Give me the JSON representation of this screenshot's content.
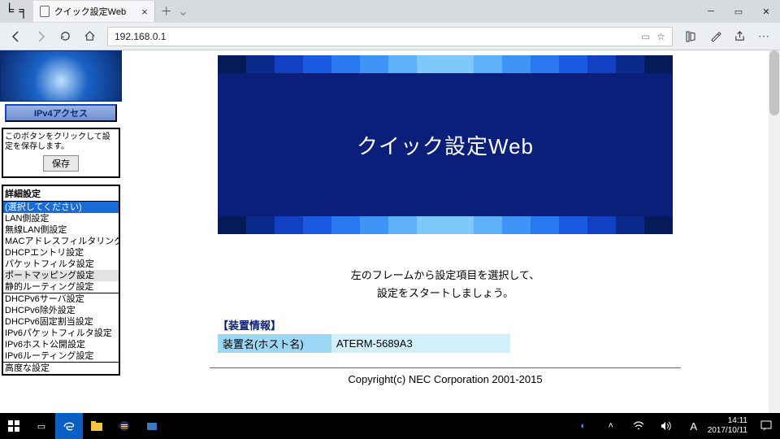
{
  "browser": {
    "tab_title": "クイック設定Web",
    "url": "192.168.0.1"
  },
  "sidebar": {
    "ipv4_button": "IPv4アクセス",
    "save_hint": "このボタンをクリックして設定を保存します。",
    "save_button": "保存",
    "list_header": "詳細設定",
    "group1": [
      "(選択してください)",
      "LAN側設定",
      "無線LAN側設定",
      "MACアドレスフィルタリング",
      "DHCPエントリ設定",
      "パケットフィルタ設定",
      "ポートマッピング設定",
      "静的ルーティング設定"
    ],
    "group2": [
      "DHCPv6サーバ設定",
      "DHCPv6除外設定",
      "DHCPv6固定割当設定",
      "IPv6パケットフィルタ設定",
      "IPv6ホスト公開設定",
      "IPv6ルーティング設定"
    ],
    "group3": [
      "高度な設定"
    ]
  },
  "banner": {
    "title": "クイック設定Web"
  },
  "main": {
    "line1": "左のフレームから設定項目を選択して、",
    "line2": "設定をスタートしましょう。",
    "info_heading": "【装置情報】",
    "row1_key": "装置名(ホスト名)",
    "row1_val": "ATERM-5689A3",
    "copyright": "Copyright(c) NEC Corporation 2001-2015"
  },
  "taskbar": {
    "time": "14:11",
    "date": "2017/10/11",
    "ime": "A"
  },
  "stripA": [
    "#061a5a",
    "#0a2a8c",
    "#1140c2",
    "#1a5ae0",
    "#2a78f0",
    "#3e94f4",
    "#5eb0f8",
    "#7ec8fc",
    "#7ec8fc",
    "#5eb0f8",
    "#3e94f4",
    "#2a78f0",
    "#1a5ae0",
    "#1140c2",
    "#0a2a8c",
    "#061a5a"
  ],
  "stripB": [
    "#061a5a",
    "#0a2a8c",
    "#1140c2",
    "#1a5ae0",
    "#2a78f0",
    "#3e94f4",
    "#5eb0f8",
    "#7ec8fc",
    "#7ec8fc",
    "#5eb0f8",
    "#3e94f4",
    "#2a78f0",
    "#1a5ae0",
    "#1140c2",
    "#0a2a8c",
    "#061a5a"
  ]
}
